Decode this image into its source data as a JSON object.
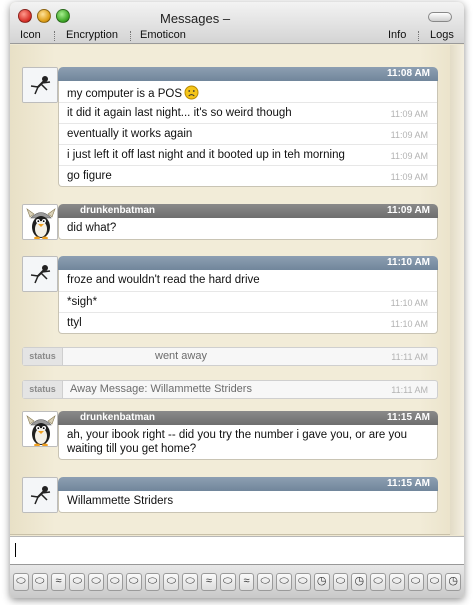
{
  "window": {
    "title": "Messages –"
  },
  "toolbar": {
    "icon": "Icon",
    "encryption": "Encryption",
    "emoticon": "Emoticon",
    "info": "Info",
    "logs": "Logs"
  },
  "colors": {
    "header_me": "#7d91a5",
    "header_them": "#7c7c7c",
    "transcript_bg": "#f2ecd8"
  },
  "transcript": {
    "block1": {
      "time": "11:08 AM",
      "avatar_icon": "stick-figure-icon",
      "lines": [
        {
          "text": "my computer is a POS",
          "emoticon": "frown-emoticon-icon",
          "time": ""
        },
        {
          "text": "it did it again last night... it's so weird though",
          "time": "11:09 AM"
        },
        {
          "text": "eventually it works again",
          "time": "11:09 AM"
        },
        {
          "text": "i just left it off last night and it booted up in teh morning",
          "time": "11:09 AM"
        },
        {
          "text": "go figure",
          "time": "11:09 AM"
        }
      ]
    },
    "block2": {
      "sender": "drunkenbatman",
      "time": "11:09 AM",
      "avatar_icon": "viking-penguin-icon",
      "lines": [
        {
          "text": "did what?",
          "time": ""
        }
      ]
    },
    "block3": {
      "time": "11:10 AM",
      "avatar_icon": "stick-figure-icon",
      "lines": [
        {
          "text": "froze and wouldn't read the hard drive",
          "time": ""
        },
        {
          "text": "*sigh*",
          "time": "11:10 AM"
        },
        {
          "text": "ttyl",
          "time": "11:10 AM"
        }
      ]
    },
    "status1": {
      "label": "status",
      "text": "went away",
      "time": "11:11 AM"
    },
    "status2": {
      "label": "status",
      "text": "Away Message: Willammette Striders",
      "time": "11:11 AM"
    },
    "block4": {
      "sender": "drunkenbatman",
      "time": "11:15 AM",
      "avatar_icon": "viking-penguin-icon",
      "lines": [
        {
          "text": "ah, your ibook right -- did you try the number i gave you, or are you waiting till you get home?",
          "time": ""
        }
      ]
    },
    "block5": {
      "time": "11:15 AM",
      "avatar_icon": "stick-figure-icon",
      "lines": [
        {
          "text": "Willammette Striders",
          "time": ""
        }
      ]
    }
  },
  "input": {
    "value": ""
  },
  "tabs": {
    "icons": [
      "chat-bubble-icon",
      "chat-bubble-icon",
      "wifi-icon",
      "chat-bubble-icon",
      "chat-bubble-icon",
      "chat-bubble-icon",
      "chat-bubble-icon",
      "chat-bubble-icon",
      "chat-bubble-icon",
      "chat-bubble-icon",
      "wifi-icon",
      "chat-bubble-icon",
      "wifi-icon",
      "chat-bubble-icon",
      "chat-bubble-icon",
      "chat-bubble-icon",
      "clock-icon",
      "chat-bubble-icon",
      "clock-icon",
      "chat-bubble-icon",
      "chat-bubble-icon",
      "chat-bubble-icon",
      "chat-bubble-icon",
      "clock-icon"
    ]
  }
}
